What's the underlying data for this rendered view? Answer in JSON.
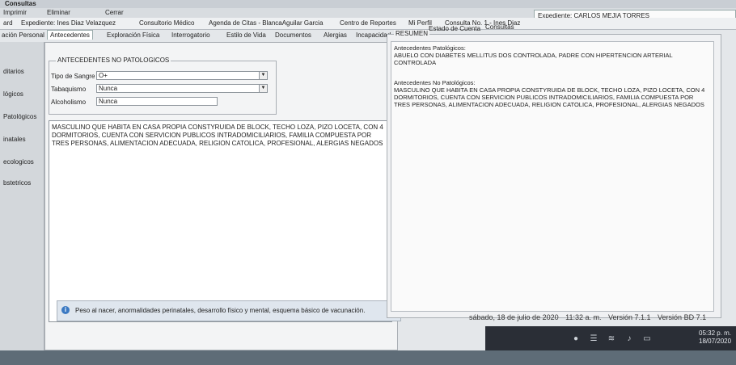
{
  "app": {
    "title": "Consultas"
  },
  "toolbar": {
    "imprimir": "Imprimir",
    "eliminar": "Eliminar",
    "cerrar": "Cerrar"
  },
  "patient_header": "Expediente: CARLOS MEJIA TORRES",
  "modules": [
    "ard",
    "Expediente: Ines Diaz Velazquez",
    "Consultorio Médico",
    "Agenda de Citas - BlancaAguilar Garcia",
    "Centro de Reportes",
    "Mi Perfil",
    "Consulta No. 1 - Ines Diaz"
  ],
  "subtabs": [
    "ación Personal",
    "Antecedentes",
    "Exploración Física",
    "Interrogatorio",
    "Estilo de Vida",
    "Documentos",
    "Alergias",
    "Incapacidad",
    "Estado de Cuenta",
    "Consultas"
  ],
  "sidebar": [
    "ditarios",
    "lógicos",
    "Patológicos",
    "inatales",
    "ecologicos",
    "bstetricos"
  ],
  "section_title": "ANTECEDENTES NO PATOLOGICOS",
  "fields": [
    {
      "label": "Tipo de Sangre",
      "value": "O+"
    },
    {
      "label": "Tabaquismo",
      "value": "Nunca"
    },
    {
      "label": "Alcoholismo",
      "value": "Nunca"
    }
  ],
  "memo_text": "MASCULINO QUE HABITA EN CASA PROPIA CONSTYRUIDA DE BLOCK, TECHO LOZA, PIZO LOCETA, CON 4 DORMITORIOS, CUENTA CON SERVICION PUBLICOS INTRADOMICILIARIOS, FAMILIA COMPUESTA POR TRES PERSONAS, ALIMENTACION ADECUADA, RELIGION CATOLICA, PROFESIONAL, ALERGIAS NEGADOS",
  "info_text": "Peso al nacer, anormalidades perinatales, desarrollo físico y mental, esquema básico de vacunación.",
  "resumen": {
    "title": "RESUMEN",
    "pat_label": "Antecedentes Patológicos:",
    "pat_text": "ABUELO CON DIABETES MELLITUS DOS CONTROLADA, PADRE CON HIPERTENCION ARTERIAL CONTROLADA",
    "nopat_label": "Antecedentes No Patológicos:",
    "nopat_text": "MASCULINO QUE HABITA EN CASA PROPIA CONSTYRUIDA DE BLOCK, TECHO LOZA, PIZO LOCETA, CON 4 DORMITORIOS, CUENTA CON SERVICION PUBLICOS INTRADOMICILIARIOS, FAMILIA COMPUESTA POR TRES PERSONAS, ALIMENTACION ADECUADA, RELIGION CATOLICA, PROFESIONAL, ALERGIAS NEGADOS"
  },
  "status": {
    "date": "sábado, 18 de julio de 2020",
    "time": "11:32 a. m.",
    "version": "Versión 7.1.1",
    "db_version": "Versión BD 7.1"
  },
  "clock": {
    "time": "05:32 p. m.",
    "date": "18/07/2020"
  },
  "colors": {
    "info_icon": "#3b79c2",
    "taskbar": "#2a2e36"
  }
}
